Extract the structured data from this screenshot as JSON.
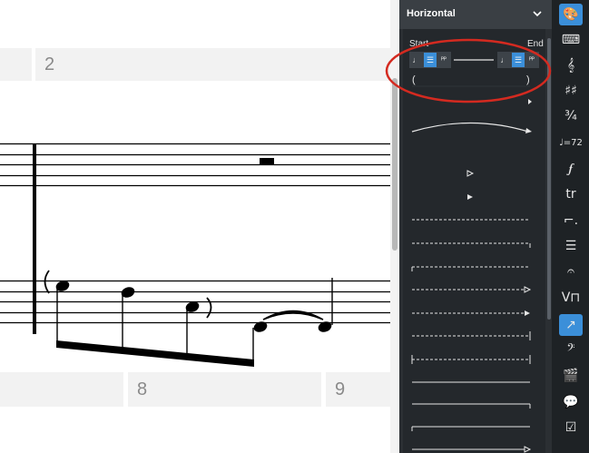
{
  "score": {
    "bar_numbers": [
      "2",
      "8",
      "9"
    ]
  },
  "panel": {
    "title": "Horizontal",
    "start_label": "Start",
    "end_label": "End",
    "paren_open": "(",
    "paren_close": ")"
  },
  "colors": {
    "accent": "#3b8fd9",
    "annotation": "#d42a20",
    "panel_bg": "#24282c",
    "toolbar_bg": "#1e2225"
  },
  "toolbar": {
    "items": [
      {
        "name": "palette-icon",
        "glyph": "🎨",
        "active": true
      },
      {
        "name": "keyboard-icon",
        "glyph": "⌨",
        "active": false
      },
      {
        "name": "treble-clef-icon",
        "glyph": "𝄞",
        "active": false
      },
      {
        "name": "key-signature-icon",
        "glyph": "♯♯",
        "active": false
      },
      {
        "name": "time-signature-icon",
        "glyph": "¾",
        "active": false
      },
      {
        "name": "tempo-icon",
        "glyph": "♩=72",
        "active": false
      },
      {
        "name": "dynamics-icon",
        "glyph": "𝆑",
        "active": false
      },
      {
        "name": "ornaments-icon",
        "glyph": "tr",
        "active": false
      },
      {
        "name": "repeats-icon",
        "glyph": "⌐.",
        "active": false
      },
      {
        "name": "tremolo-icon",
        "glyph": "☰",
        "active": false
      },
      {
        "name": "fermata-icon",
        "glyph": "𝄐",
        "active": false
      },
      {
        "name": "bowing-icon",
        "glyph": "V⊓",
        "active": false
      },
      {
        "name": "lines-icon",
        "glyph": "↗",
        "active": true
      },
      {
        "name": "hearing-icon",
        "glyph": "𝄢",
        "active": false
      },
      {
        "name": "clapperboard-icon",
        "glyph": "🎬",
        "active": false
      },
      {
        "name": "comment-icon",
        "glyph": "💬",
        "active": false
      },
      {
        "name": "checklist-icon",
        "glyph": "☑",
        "active": false
      }
    ]
  }
}
